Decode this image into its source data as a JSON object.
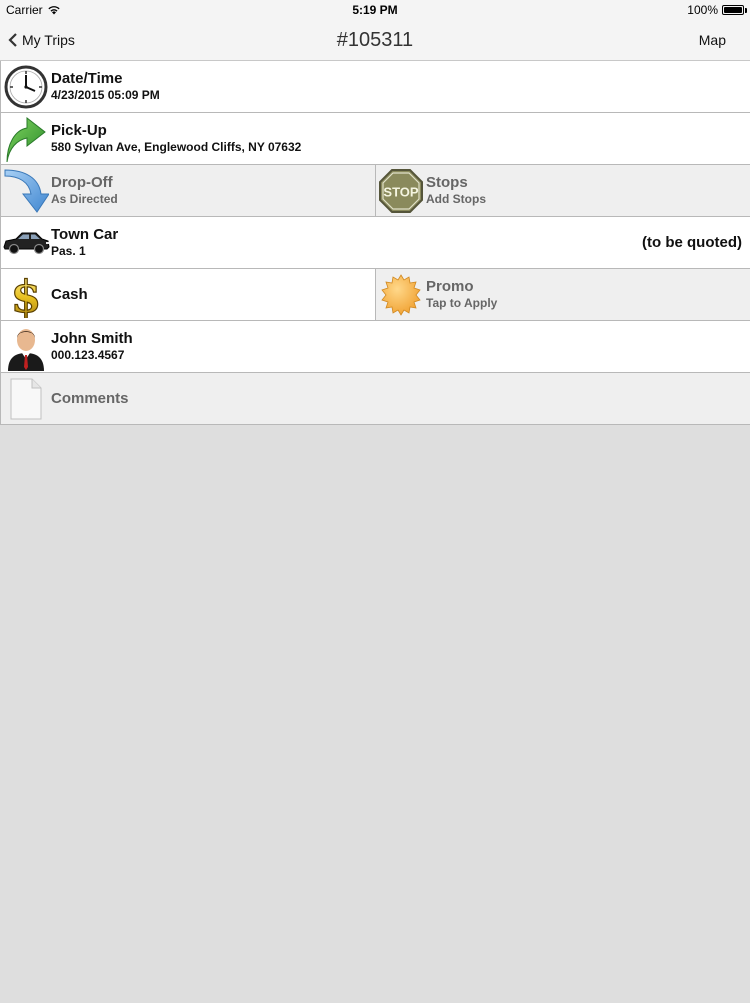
{
  "status": {
    "carrier": "Carrier",
    "time": "5:19 PM",
    "battery": "100%"
  },
  "nav": {
    "back_label": "My Trips",
    "title": "#105311",
    "right_label": "Map"
  },
  "rows": {
    "datetime": {
      "title": "Date/Time",
      "value": "4/23/2015 05:09 PM"
    },
    "pickup": {
      "title": "Pick-Up",
      "value": "580 Sylvan Ave, Englewood Cliffs, NY 07632"
    },
    "dropoff": {
      "title": "Drop-Off",
      "value": "As Directed"
    },
    "stops": {
      "title": "Stops",
      "value": "Add Stops",
      "icon_text": "STOP"
    },
    "vehicle": {
      "title": "Town Car",
      "value": "Pas. 1",
      "price": "(to be quoted)"
    },
    "payment": {
      "title": "Cash"
    },
    "promo": {
      "title": "Promo",
      "value": "Tap to Apply"
    },
    "passenger": {
      "title": "John Smith",
      "value": "000.123.4567"
    },
    "comments": {
      "title": "Comments"
    }
  },
  "colors": {
    "background": "#dedede",
    "bar": "#f4f4f4",
    "cell_white": "#ffffff",
    "cell_gray": "#efefef",
    "arrow_green": "#3aa83a",
    "arrow_blue": "#5aa0e0",
    "stop_olive": "#7a7a52",
    "promo_orange": "#f5b040",
    "dollar_gold": "#e8c020"
  }
}
